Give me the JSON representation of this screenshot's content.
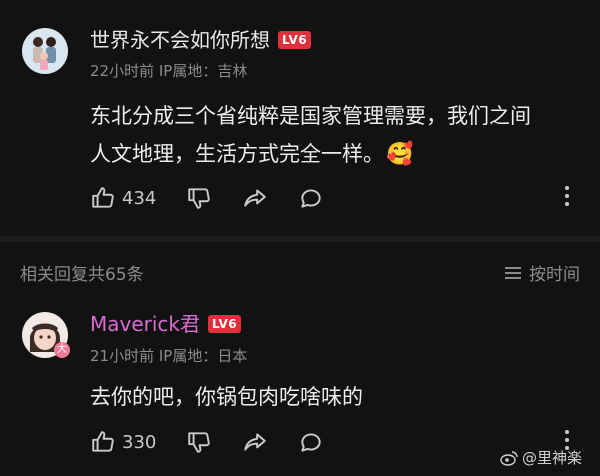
{
  "comments": [
    {
      "username": "世界永不会如你所想",
      "level": "LV6",
      "meta": "22小时前 IP属地：吉林",
      "text_lines": [
        "东北分成三个省纯粹是国家管理需要，我们之间",
        "人文地理，生活方式完全一样。"
      ],
      "emoji": "🥰",
      "likes": "434"
    },
    {
      "username": "Maverick君",
      "username_color": "#d96bd2",
      "level": "LV6",
      "meta": "21小时前 IP属地：日本",
      "text_lines": [
        "去你的吧，你锅包肉吃啥味的"
      ],
      "likes": "330"
    }
  ],
  "replies": {
    "count_label": "相关回复共65条",
    "sort_label": "按时间"
  },
  "watermark": "@里神楽",
  "colors": {
    "background": "#121212",
    "level_badge": "#e0303c",
    "meta": "#8b8b8b"
  }
}
